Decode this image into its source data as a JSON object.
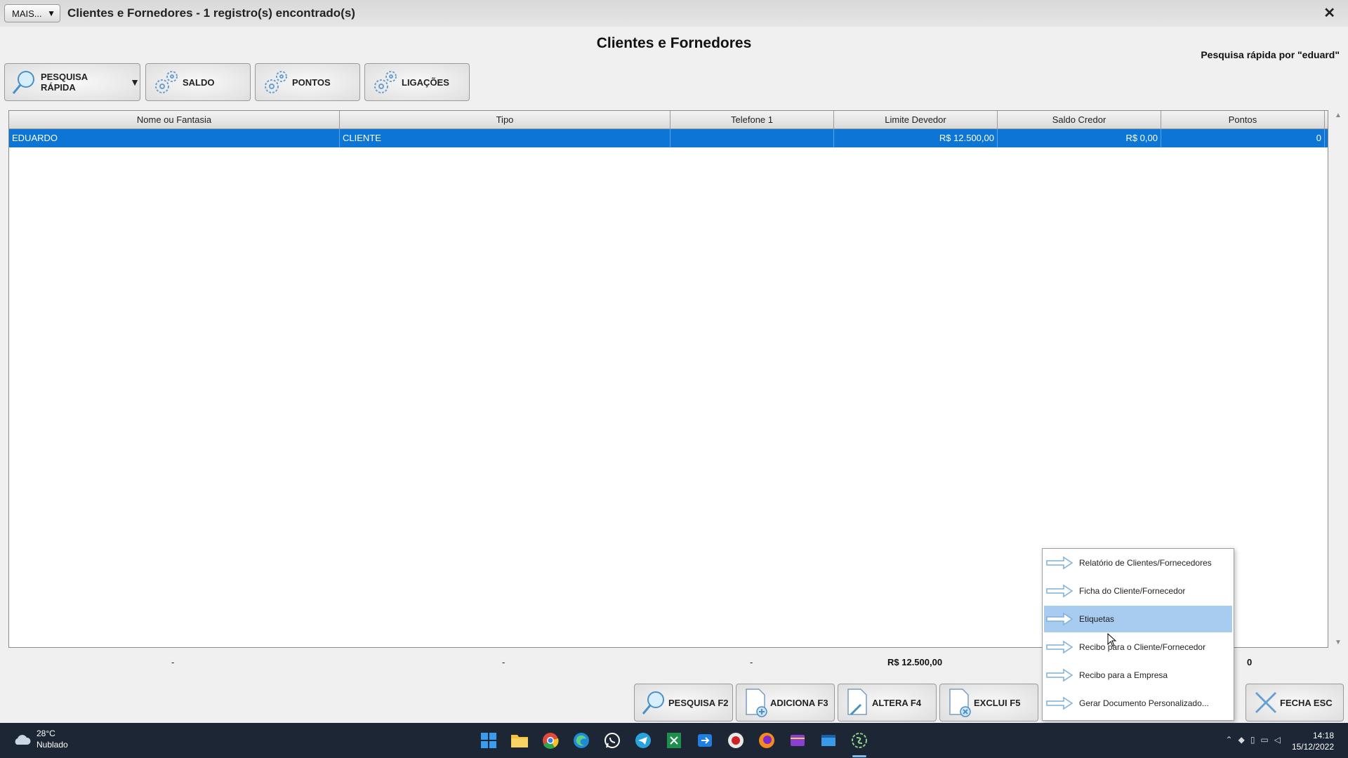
{
  "window": {
    "title": "Clientes e Fornedores - 1 registro(s) encontrado(s)",
    "mais_label": "MAIS...",
    "close_label": "✕"
  },
  "page": {
    "title": "Clientes e Fornedores",
    "quick_search_status": "Pesquisa rápida por \"eduard\""
  },
  "toolbar": {
    "quick_search": "PESQUISA RÁPIDA",
    "saldo": "SALDO",
    "pontos": "PONTOS",
    "ligacoes": "LIGAÇÕES"
  },
  "grid": {
    "columns": [
      "Nome ou Fantasia",
      "Tipo",
      "Telefone 1",
      "Limite Devedor",
      "Saldo Credor",
      "Pontos"
    ],
    "rows": [
      {
        "nome": "EDUARDO",
        "tipo": "CLIENTE",
        "telefone": "",
        "limite": "R$ 12.500,00",
        "saldo": "R$ 0,00",
        "pontos": "0"
      }
    ]
  },
  "totals": {
    "nome": "-",
    "tipo": "-",
    "telefone": "-",
    "limite": "R$ 12.500,00",
    "pontos": "0"
  },
  "actions": {
    "pesquisa": "PESQUISA F2",
    "adiciona": "ADICIONA F3",
    "altera": "ALTERA F4",
    "exclui": "EXCLUI F5",
    "fecha": "FECHA ESC"
  },
  "context_menu": {
    "items": [
      "Relatório de Clientes/Fornecedores",
      "Ficha do Cliente/Fornecedor",
      "Etiquetas",
      "Recibo para o Cliente/Fornecedor",
      "Recibo para a Empresa",
      "Gerar Documento Personalizado..."
    ],
    "highlighted": "Etiquetas"
  },
  "taskbar": {
    "temperature": "28°C",
    "weather": "Nublado",
    "time": "14:18",
    "date": "15/12/2022"
  },
  "colors": {
    "selection": "#0c75d6",
    "menu_highlight": "#a8cbf0",
    "taskbar": "#1d2634"
  }
}
